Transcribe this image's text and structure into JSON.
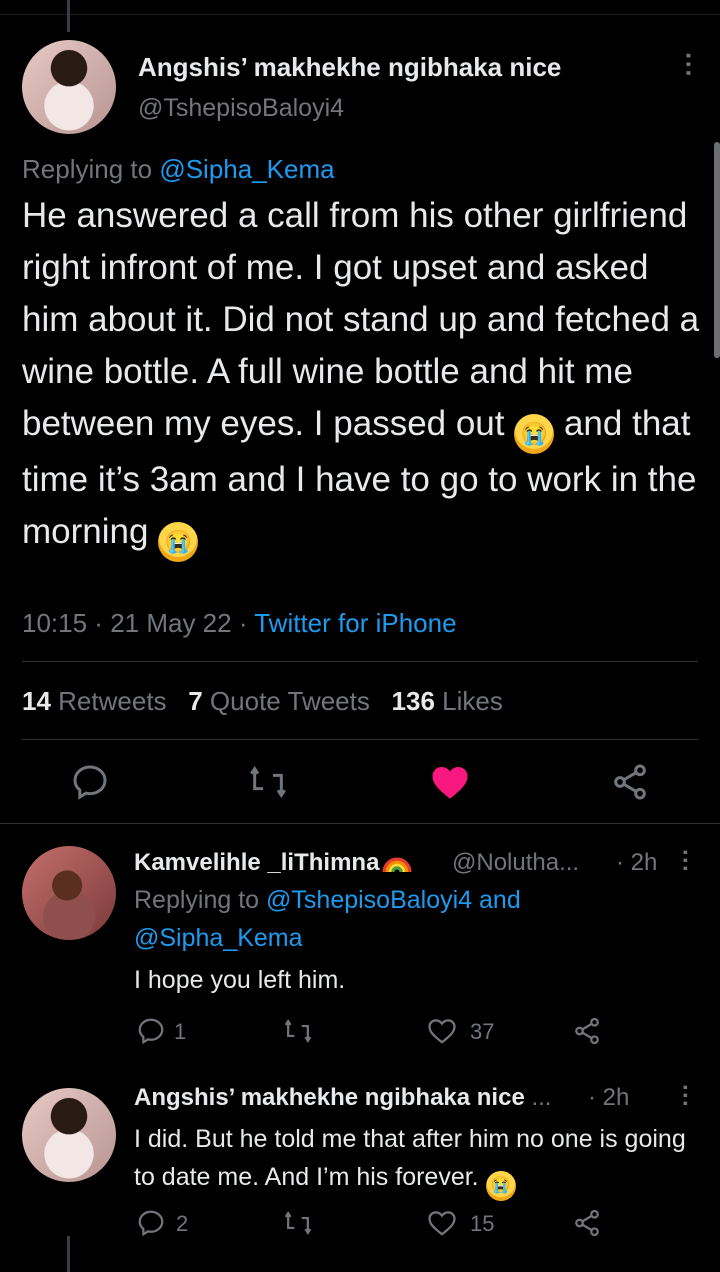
{
  "colors": {
    "background": "#000000",
    "text": "#e7e9ea",
    "muted": "#71767b",
    "link": "#1d9bf0",
    "like": "#f91880"
  },
  "main_tweet": {
    "author_name": "Angshis’ makhekhe ngibhaka nice",
    "author_handle": "@TshepisoBaloyi4",
    "replying_label": "Replying to",
    "replying_to": "@Sipha_Kema",
    "text_part1": "He answered a call from his other girlfriend right infront of me. I got upset and asked him about it. Did not stand up and fetched a wine bottle. A full wine bottle and hit me between my eyes. I passed out",
    "text_part2": "and that time it’s 3am and I have to go to work in the morning",
    "emoji": "😭",
    "time": "10:15",
    "date": "21 May 22",
    "client": "Twitter for iPhone",
    "retweets_count": "14",
    "retweets_label": "Retweets",
    "quotes_count": "7",
    "quotes_label": "Quote Tweets",
    "likes_count": "136",
    "likes_label": "Likes",
    "liked": true
  },
  "replies": [
    {
      "author_name": "Kamvelihle _liThimna",
      "author_handle": "@Nolutha...",
      "time": "· 2h",
      "replying_label": "Replying to",
      "replying_to_1": "@TshepisoBaloyi4",
      "replying_and": "and",
      "replying_to_2": "@Sipha_Kema",
      "text": "I hope you left him.",
      "reply_count": "1",
      "like_count": "37"
    },
    {
      "author_name": "Angshis’ makhekhe ngibhaka nice",
      "truncation": "...",
      "time": "· 2h",
      "text": "I did. But he told me that after him no one is going to date me. And I’m his forever.",
      "emoji": "😭",
      "reply_count": "2",
      "like_count": "15"
    }
  ],
  "icons": [
    "more-vertical-icon",
    "reply-icon",
    "retweet-icon",
    "heart-icon",
    "share-icon",
    "rainbow-icon",
    "crying-emoji"
  ]
}
